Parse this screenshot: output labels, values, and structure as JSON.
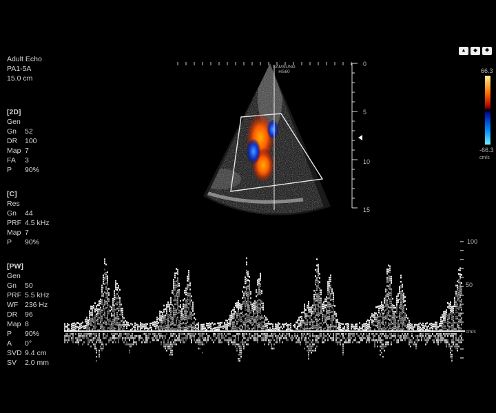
{
  "header": {
    "preset": "Adult Echo",
    "probe": "PA1-5A",
    "depth": "15.0 cm"
  },
  "brand": {
    "line1": "SAMSUNG",
    "line2": "HS60"
  },
  "mode_2d": {
    "title": "[2D]",
    "params": [
      {
        "k": "Gen",
        "v": ""
      },
      {
        "k": "Gn",
        "v": "52"
      },
      {
        "k": "DR",
        "v": "100"
      },
      {
        "k": "Map",
        "v": "7"
      },
      {
        "k": "FA",
        "v": "3"
      },
      {
        "k": "P",
        "v": "90%"
      }
    ]
  },
  "mode_c": {
    "title": "[C]",
    "params": [
      {
        "k": "Res",
        "v": ""
      },
      {
        "k": "Gn",
        "v": "44"
      },
      {
        "k": "PRF",
        "v": "4.5 kHz"
      },
      {
        "k": "Map",
        "v": "7"
      },
      {
        "k": "P",
        "v": "90%"
      }
    ]
  },
  "mode_pw": {
    "title": "[PW]",
    "params": [
      {
        "k": "Gen",
        "v": ""
      },
      {
        "k": "Gn",
        "v": "50"
      },
      {
        "k": "PRF",
        "v": "5.5 kHz"
      },
      {
        "k": "WF",
        "v": "236 Hz"
      },
      {
        "k": "DR",
        "v": "96"
      },
      {
        "k": "Map",
        "v": "8"
      },
      {
        "k": "P",
        "v": "90%"
      },
      {
        "k": "A",
        "v": "0°"
      },
      {
        "k": "SVD",
        "v": "9.4 cm"
      },
      {
        "k": "SV",
        "v": "2.0 mm"
      }
    ]
  },
  "color_scale": {
    "max": "66.3",
    "min": "-66.3",
    "unit": "cm/s",
    "colors": [
      "#ffe070",
      "#ff6a00",
      "#b00000",
      "#000000",
      "#0020a0",
      "#00a0ff",
      "#60e8ff"
    ]
  },
  "depth_scale": {
    "labels": [
      "0",
      "5",
      "10",
      "15"
    ]
  },
  "doppler_scale": {
    "labels": [
      "100",
      "50"
    ],
    "unit": "cm/s"
  },
  "icons": [
    "camera-icon",
    "nav-icon",
    "settings-icon"
  ]
}
